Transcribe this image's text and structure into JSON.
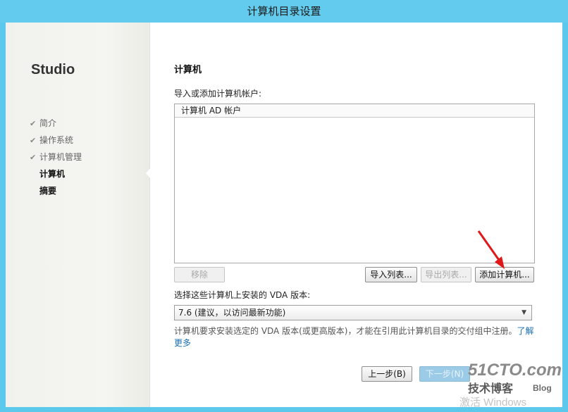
{
  "window": {
    "title": "计算机目录设置"
  },
  "sidebar": {
    "brand": "Studio",
    "items": [
      {
        "label": "简介",
        "state": "done"
      },
      {
        "label": "操作系统",
        "state": "done"
      },
      {
        "label": "计算机管理",
        "state": "done"
      },
      {
        "label": "计算机",
        "state": "current"
      },
      {
        "label": "摘要",
        "state": "pending"
      }
    ]
  },
  "main": {
    "title": "计算机",
    "import_label": "导入或添加计算机帐户:",
    "list": {
      "column_header": "计算机 AD 帐户",
      "rows": []
    },
    "buttons": {
      "remove": "移除",
      "import_list": "导入列表...",
      "export_list": "导出列表...",
      "add_computers": "添加计算机..."
    },
    "vda_label": "选择这些计算机上安装的 VDA 版本:",
    "vda_select": {
      "value": "7.6 (建议，以访问最新功能)"
    },
    "note": "计算机要求安装选定的 VDA 版本(或更高版本)，才能在引用此计算机目录的交付组中注册。",
    "learn_more": "了解更多"
  },
  "footer": {
    "back": "上一步(B)",
    "next": "下一步(N)"
  },
  "watermark": {
    "site": "51CTO.com",
    "blog": "技术博客",
    "blog_en": "Blog",
    "activate": "激活 Windows"
  },
  "colors": {
    "titlebar": "#63cbee",
    "arrow": "#e01818",
    "link": "#1a6fb3"
  },
  "icons": {
    "check": "checkmark-icon",
    "dropdown": "chevron-down-icon"
  }
}
